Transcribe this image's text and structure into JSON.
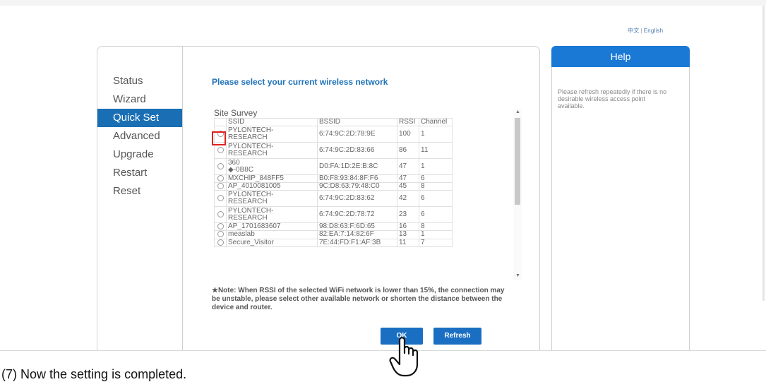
{
  "language": {
    "chinese": "中文",
    "separator": "|",
    "english": "English"
  },
  "sidebar": {
    "items": [
      {
        "label": "Status",
        "active": false
      },
      {
        "label": "Wizard",
        "active": false
      },
      {
        "label": "Quick Set",
        "active": true
      },
      {
        "label": "Advanced",
        "active": false
      },
      {
        "label": "Upgrade",
        "active": false
      },
      {
        "label": "Restart",
        "active": false
      },
      {
        "label": "Reset",
        "active": false
      }
    ]
  },
  "main": {
    "heading": "Please select your current wireless network",
    "survey_label": "Site Survey",
    "columns": [
      "SSID",
      "BSSID",
      "RSSI",
      "Channel"
    ],
    "rows": [
      {
        "ssid": "PYLONTECH-\nRESEARCH",
        "bssid": "6:74:9C:2D:78:9E",
        "rssi": "100",
        "channel": "1"
      },
      {
        "ssid": "PYLONTECH-\nRESEARCH",
        "bssid": "6:74:9C:2D:83:66",
        "rssi": "86",
        "channel": "11"
      },
      {
        "ssid": "360        \n◆-0B8C",
        "bssid": "D0:FA:1D:2E:B:8C",
        "rssi": "47",
        "channel": "1"
      },
      {
        "ssid": "MXCHIP_848FF5",
        "bssid": "B0:F8:93:84:8F:F6",
        "rssi": "47",
        "channel": "6"
      },
      {
        "ssid": "AP_4010081005",
        "bssid": "9C:D8:63:79:48:C0",
        "rssi": "45",
        "channel": "8"
      },
      {
        "ssid": "PYLONTECH-\nRESEARCH",
        "bssid": "6:74:9C:2D:83:62",
        "rssi": "42",
        "channel": "6"
      },
      {
        "ssid": "PYLONTECH-\nRESEARCH",
        "bssid": "6:74:9C:2D:78:72",
        "rssi": "23",
        "channel": "6"
      },
      {
        "ssid": "AP_1701683607",
        "bssid": "98:D8:63:F:6D:65",
        "rssi": "16",
        "channel": "8"
      },
      {
        "ssid": "measlab",
        "bssid": "82:EA:7:14:82:6F",
        "rssi": "13",
        "channel": "1"
      },
      {
        "ssid": "Secure_Visitor",
        "bssid": "7E:44:FD:F1:AF:3B",
        "rssi": "11",
        "channel": "7"
      }
    ],
    "note": "★Note: When RSSI of the selected WiFi network is lower than 15%, the connection may be unstable, please select other available network or shorten the distance between the device and router.",
    "ok_label": "OK",
    "refresh_label": "Refresh"
  },
  "help": {
    "title": "Help",
    "text": "Please refresh repeatedly if there is no desirable wireless access point available."
  },
  "caption": "(7)  Now the setting is completed.",
  "colors": {
    "accent": "#1a6fb4",
    "help_header": "#1b79d6",
    "highlight": "#e0201f"
  },
  "icons": {
    "cursor": "hand-pointer-icon",
    "radio": "radio-icon"
  }
}
